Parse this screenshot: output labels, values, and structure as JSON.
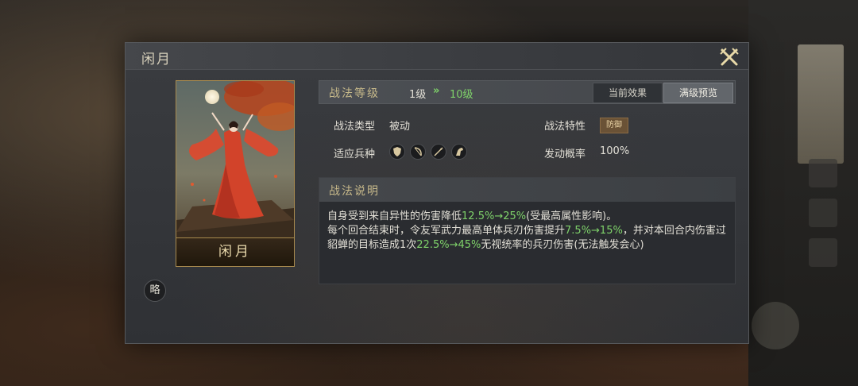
{
  "dialog": {
    "title": "闲月",
    "close_icon": "crossed-swords-close-icon"
  },
  "card": {
    "name": "闲月"
  },
  "strategy_button": {
    "label": "略"
  },
  "level": {
    "label": "战法等级",
    "from": "1级",
    "arrow": "»",
    "to": "10级"
  },
  "tabs": {
    "current": "当前效果",
    "max": "满级预览"
  },
  "fields": {
    "type_label": "战法类型",
    "type_value": "被动",
    "trait_label": "战法特性",
    "trait_value": "防御",
    "units_label": "适应兵种",
    "units_icons": [
      "shield-unit-icon",
      "bow-unit-icon",
      "spear-unit-icon",
      "horse-unit-icon"
    ],
    "chance_label": "发动概率",
    "chance_value": "100%"
  },
  "description": {
    "label": "战法说明",
    "line1_a": "自身受到来自异性的伤害降低",
    "line1_hl": "12.5%→25%",
    "line1_b": "(受最高属性影响)。",
    "line2_a": "每个回合结束时，令友军武力最高单体兵刃伤害提升",
    "line2_hl": "7.5%→15%",
    "line2_b": "，并对本回合内伤害过貂蝉的目标造成1次",
    "line2_hl2": "22.5%→45%",
    "line2_c": "无视统率的兵刃伤害(无法触发会心)"
  },
  "colors": {
    "highlight": "#7fd36a",
    "gold": "#c7b98a",
    "panel": "#3a3c40"
  }
}
